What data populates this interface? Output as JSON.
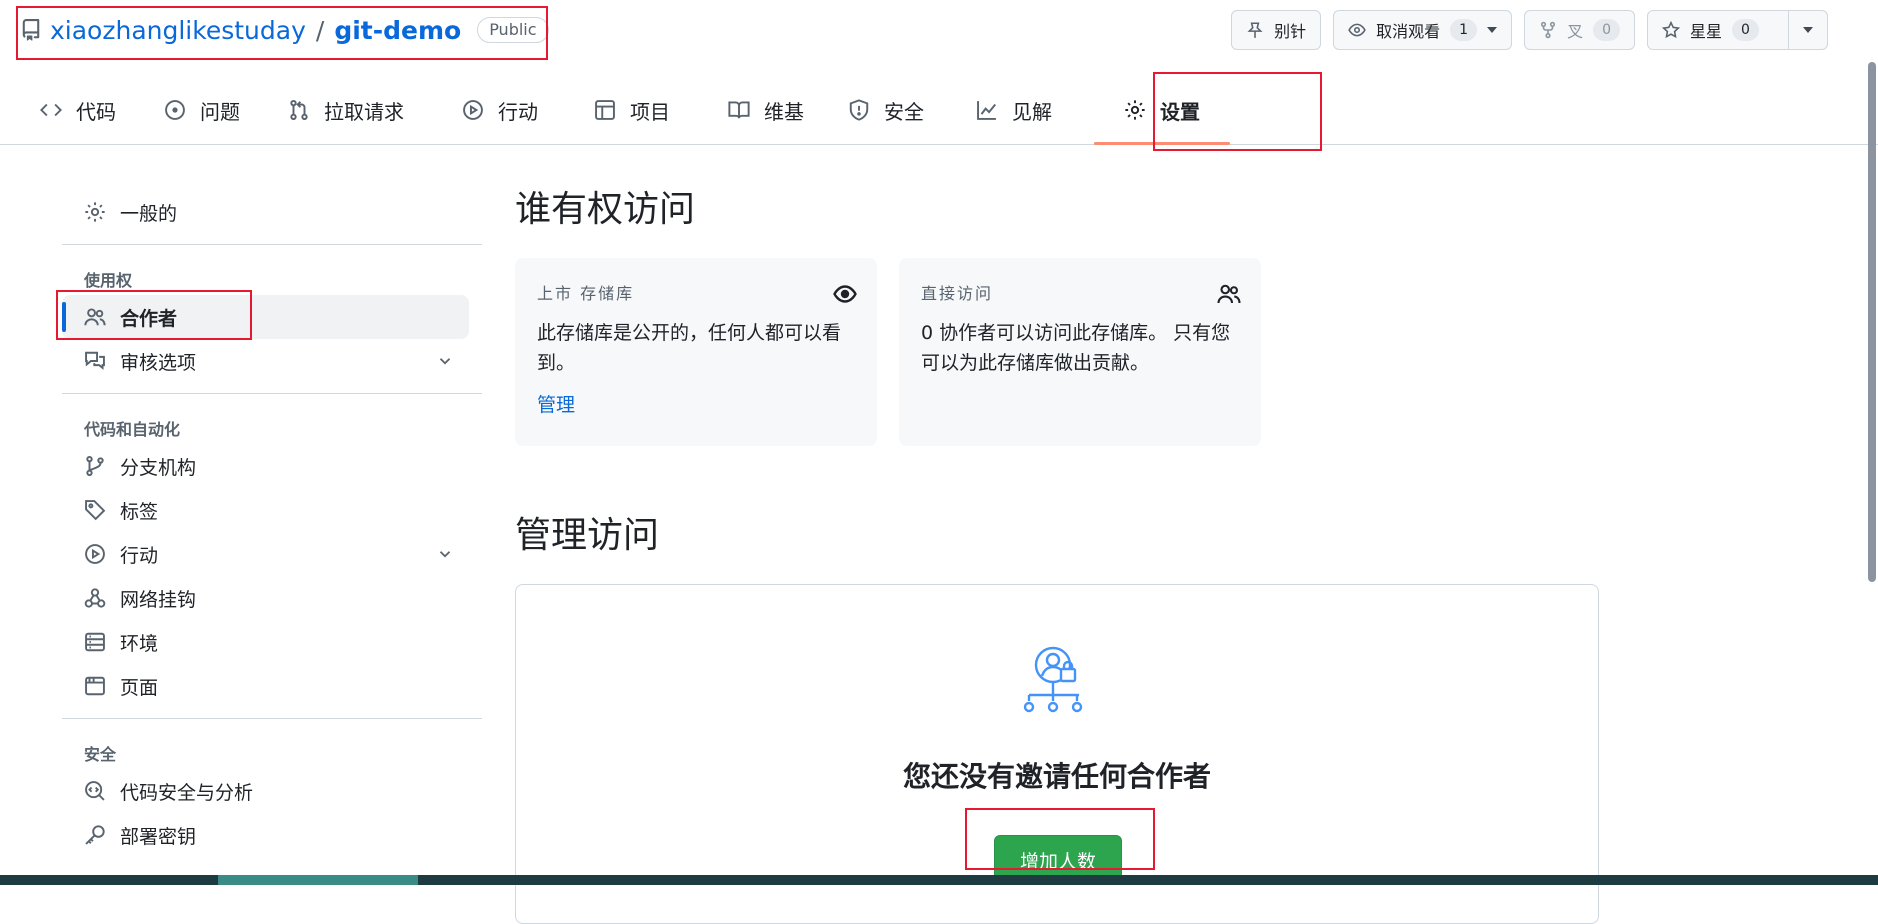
{
  "repo": {
    "owner": "xiaozhanglikestuday",
    "separator": "/",
    "name": "git-demo",
    "visibility": "Public"
  },
  "actions": {
    "pin": "别针",
    "unwatch": "取消观看",
    "watch_count": "1",
    "fork": "叉",
    "fork_count": "0",
    "star": "星星",
    "star_count": "0"
  },
  "tabs": [
    {
      "label": "代码",
      "icon": "code-icon"
    },
    {
      "label": "问题",
      "icon": "issue-icon"
    },
    {
      "label": "拉取请求",
      "icon": "pull-request-icon"
    },
    {
      "label": "行动",
      "icon": "play-icon"
    },
    {
      "label": "项目",
      "icon": "table-icon"
    },
    {
      "label": "维基",
      "icon": "book-icon"
    },
    {
      "label": "安全",
      "icon": "shield-icon"
    },
    {
      "label": "见解",
      "icon": "graph-icon"
    },
    {
      "label": "设置",
      "icon": "gear-icon",
      "selected": true
    }
  ],
  "sidebar": {
    "general": "一般的",
    "access_label": "使用权",
    "collaborators": "合作者",
    "moderation": "审核选项",
    "code_automation_label": "代码和自动化",
    "branches": "分支机构",
    "tags": "标签",
    "actions": "行动",
    "webhooks": "网络挂钩",
    "environments": "环境",
    "pages": "页面",
    "security_label": "安全",
    "code_security": "代码安全与分析",
    "deploy_keys": "部署密钥"
  },
  "main": {
    "who_title": "谁有权访问",
    "card_public": {
      "label": "上市  存储库",
      "text": "此存储库是公开的，任何人都可以看到。",
      "link": "管理"
    },
    "card_direct": {
      "label": "直接访问",
      "text": "0 协作者可以访问此存储库。 只有您可以为此存储库做出贡献。"
    },
    "manage_title": "管理访问",
    "empty_text": "您还没有邀请任何合作者",
    "add_button": "增加人数"
  },
  "colors": {
    "accent": "#0969da",
    "primary_button": "#2da44e",
    "annotation": "#e5192f"
  }
}
